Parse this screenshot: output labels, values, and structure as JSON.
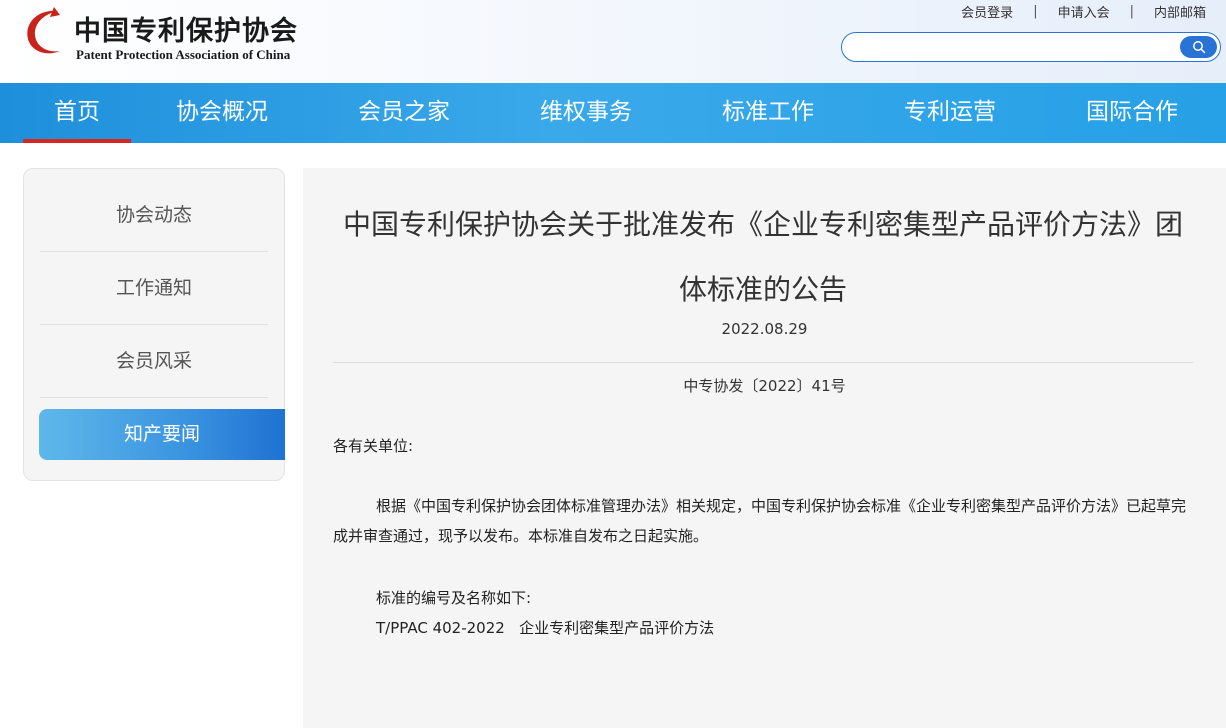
{
  "header": {
    "logo_cn": "中国专利保护协会",
    "logo_en": "Patent Protection Association of China",
    "links": [
      "会员登录",
      "申请入会",
      "内部邮箱"
    ],
    "search": {
      "value": "",
      "placeholder": ""
    }
  },
  "nav": {
    "items": [
      "首页",
      "协会概况",
      "会员之家",
      "维权事务",
      "标准工作",
      "专利运营",
      "国际合作"
    ],
    "active": "首页"
  },
  "sidebar": {
    "items": [
      "协会动态",
      "工作通知",
      "会员风采",
      "知产要闻"
    ],
    "active": "知产要闻"
  },
  "article": {
    "title": "中国专利保护协会关于批准发布《企业专利密集型产品评价方法》团体标准的公告",
    "date": "2022.08.29",
    "doc_no": "中专协发〔2022〕41号",
    "salutation": "各有关单位:",
    "body": "根据《中国专利保护协会团体标准管理办法》相关规定，中国专利保护协会标准《企业专利密集型产品评价方法》已起草完成并审查通过，现予以发布。本标准自发布之日起实施。",
    "list_intro": "标准的编号及名称如下:",
    "standard": "T/PPAC 402-2022   企业专利密集型产品评价方法"
  },
  "colors": {
    "accent": "#2a73d6",
    "nav": "#26a0e6",
    "active_marker": "#d7261e"
  }
}
